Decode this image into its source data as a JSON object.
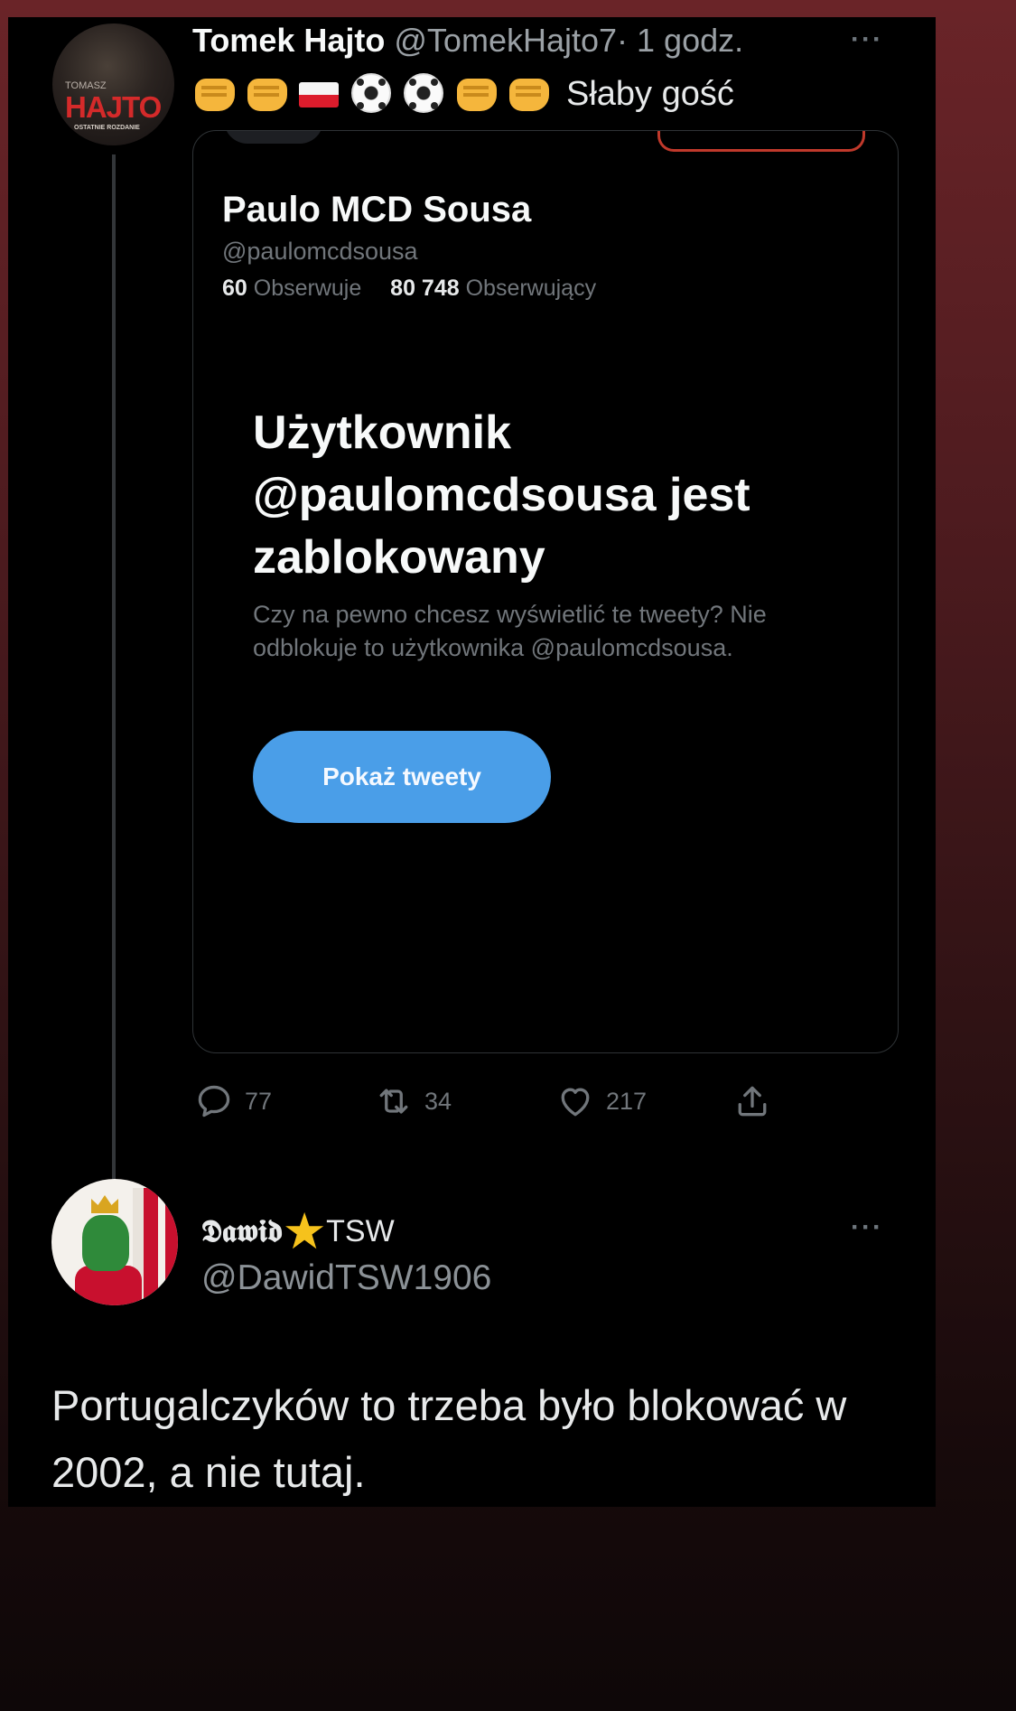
{
  "tweet1": {
    "author_name": "Tomek Hajto",
    "author_handle": "@TomekHajto7",
    "time": "· 1 godz.",
    "more_label": "···",
    "avatar_text_top": "TOMASZ",
    "avatar_brand": "HAJTO",
    "avatar_subtitle": "OSTATNIE ROZDANIE",
    "emoji_sequence": [
      "oncoming-fist",
      "oncoming-fist",
      "flag-poland",
      "soccer-ball",
      "soccer-ball",
      "oncoming-fist",
      "oncoming-fist"
    ],
    "text": "Słaby gość",
    "quoted_profile": {
      "display_name": "Paulo MCD Sousa",
      "handle": "@paulomcdsousa",
      "following_count": "60",
      "following_label": "Obserwuje",
      "followers_count": "80 748",
      "followers_label": "Obserwujący",
      "blocked_title": "Użytkownik @paulomcdsousa jest zablokowany",
      "blocked_description": "Czy na pewno chcesz wyświetlić te tweety? Nie odblokuje to użytkownika @paulomcdsousa.",
      "show_button_label": "Pokaż tweety"
    },
    "actions": {
      "replies": "77",
      "retweets": "34",
      "likes": "217"
    }
  },
  "tweet2": {
    "author_name": "𝕯𝖆𝖜𝖎𝖉",
    "author_name_suffix": "TSW",
    "author_handle": "@DawidTSW1906",
    "more_label": "···",
    "text": "Portugalczyków to trzeba było blokować w 2002, a nie tutaj."
  },
  "colors": {
    "background_top": "#6a2428",
    "background_bottom": "#0e0708",
    "screen_bg": "#000000",
    "text_primary": "#e7e9ea",
    "text_secondary": "#71767b",
    "button_blue": "#4a9ee8",
    "card_border": "#2f3336"
  }
}
